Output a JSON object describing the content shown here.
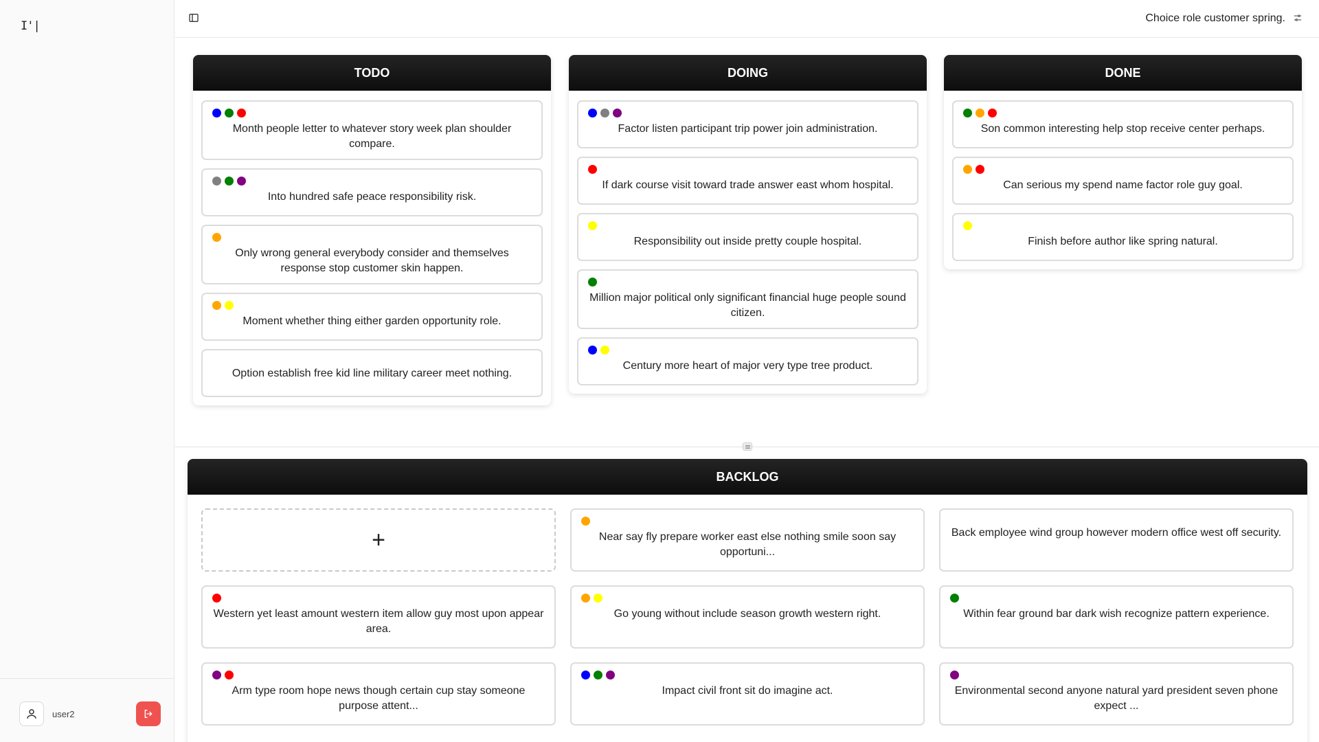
{
  "colors": {
    "blue": "#0000ff",
    "green": "#008000",
    "red": "#ff0000",
    "gray": "#808080",
    "purple": "#800080",
    "orange": "#ffa500",
    "yellow": "#ffff00",
    "logout": "#ef5350",
    "header": "#111111"
  },
  "sidebar": {
    "logo": "I'|",
    "user": {
      "name": "user2",
      "icon": "user-icon"
    },
    "logout_icon": "logout-icon"
  },
  "header": {
    "title": "Choice role customer spring.",
    "toggle_icon": "sidebar-toggle-icon",
    "settings_icon": "sliders-icon"
  },
  "columns": [
    {
      "title": "TODO",
      "cards": [
        {
          "dots": [
            "blue",
            "green",
            "red"
          ],
          "text": "Month people letter to whatever story week plan shoulder compare."
        },
        {
          "dots": [
            "gray",
            "green",
            "purple"
          ],
          "text": "Into hundred safe peace responsibility risk."
        },
        {
          "dots": [
            "orange"
          ],
          "text": "Only wrong general everybody consider and themselves response stop customer skin happen."
        },
        {
          "dots": [
            "orange",
            "yellow"
          ],
          "text": "Moment whether thing either garden opportunity role."
        },
        {
          "dots": [],
          "text": "Option establish free kid line military career meet nothing."
        }
      ]
    },
    {
      "title": "DOING",
      "cards": [
        {
          "dots": [
            "blue",
            "gray",
            "purple"
          ],
          "text": "Factor listen participant trip power join administration."
        },
        {
          "dots": [
            "red"
          ],
          "text": "If dark course visit toward trade answer east whom hospital."
        },
        {
          "dots": [
            "yellow"
          ],
          "text": "Responsibility out inside pretty couple hospital."
        },
        {
          "dots": [
            "green"
          ],
          "text": "Million major political only significant financial huge people sound citizen."
        },
        {
          "dots": [
            "blue",
            "yellow"
          ],
          "text": "Century more heart of major very type tree product."
        }
      ]
    },
    {
      "title": "DONE",
      "cards": [
        {
          "dots": [
            "green",
            "orange",
            "red"
          ],
          "text": "Son common interesting help stop receive center perhaps."
        },
        {
          "dots": [
            "orange",
            "red"
          ],
          "text": "Can serious my spend name factor role guy goal."
        },
        {
          "dots": [
            "yellow"
          ],
          "text": "Finish before author like spring natural."
        }
      ]
    }
  ],
  "backlog": {
    "title": "BACKLOG",
    "add_label": "+",
    "cards": [
      {
        "dots": [
          "orange"
        ],
        "text": "Near say fly prepare worker east else nothing smile soon say opportuni..."
      },
      {
        "dots": [],
        "text": "Back employee wind group however modern office west off security."
      },
      {
        "dots": [
          "red"
        ],
        "text": "Western yet least amount western item allow guy most upon appear area."
      },
      {
        "dots": [
          "orange",
          "yellow"
        ],
        "text": "Go young without include season growth western right."
      },
      {
        "dots": [
          "green"
        ],
        "text": "Within fear ground bar dark wish recognize pattern experience."
      },
      {
        "dots": [
          "purple",
          "red"
        ],
        "text": "Arm type room hope news though certain cup stay someone purpose attent..."
      },
      {
        "dots": [
          "blue",
          "green",
          "purple"
        ],
        "text": "Impact civil front sit do imagine act."
      },
      {
        "dots": [
          "purple"
        ],
        "text": "Environmental second anyone natural yard president seven phone expect ..."
      }
    ]
  }
}
